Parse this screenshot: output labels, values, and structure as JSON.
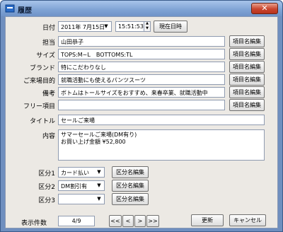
{
  "window": {
    "title": "履歴",
    "close_glyph": "✕"
  },
  "date_row": {
    "label": "日付",
    "date": "2011年 7月15日",
    "time": "15:51:53",
    "now_button": "現在日時"
  },
  "fields": [
    {
      "label": "担当",
      "value": "山田恭子",
      "button": "項目名編集"
    },
    {
      "label": "サイズ",
      "value": "TOPS:M~L　BOTTOMS:TL",
      "button": "項目名編集"
    },
    {
      "label": "ブランド",
      "value": "特にこだわりなし",
      "button": "項目名編集"
    },
    {
      "label": "ご来場目的",
      "value": "就職活動にも使えるパンツスーツ",
      "button": "項目名編集"
    },
    {
      "label": "備考",
      "value": "ボトムはトールサイズをおすすめ、来春卒業、就職活動中",
      "button": "項目名編集"
    },
    {
      "label": "フリー項目",
      "value": "",
      "button": "項目名編集"
    }
  ],
  "title_field": {
    "label": "タイトル",
    "value": "セールご来場"
  },
  "content_field": {
    "label": "内容",
    "line1": "サマーセールご来場(DM有り)",
    "line2": "お買い上げ金額 ¥52,800"
  },
  "categories": [
    {
      "label": "区分1",
      "value": "カード払い",
      "button": "区分名編集"
    },
    {
      "label": "区分2",
      "value": "DM割引有",
      "button": "区分名編集"
    },
    {
      "label": "区分3",
      "value": "",
      "button": "区分名編集"
    }
  ],
  "footer": {
    "count_label": "表示件数",
    "count_value": "4/9",
    "nav_first": "<<",
    "nav_prev": "<",
    "nav_next": ">",
    "nav_last": ">>",
    "update_button": "更新",
    "cancel_button": "キャンセル"
  },
  "icons": {
    "app": "window-app-icon",
    "dropdown": "chevron-down-icon",
    "spin": "spin-updown-icon"
  },
  "colors": {
    "titlebar": "#7ea2d4",
    "close": "#c9452e",
    "client_bg": "#ece9e4"
  }
}
